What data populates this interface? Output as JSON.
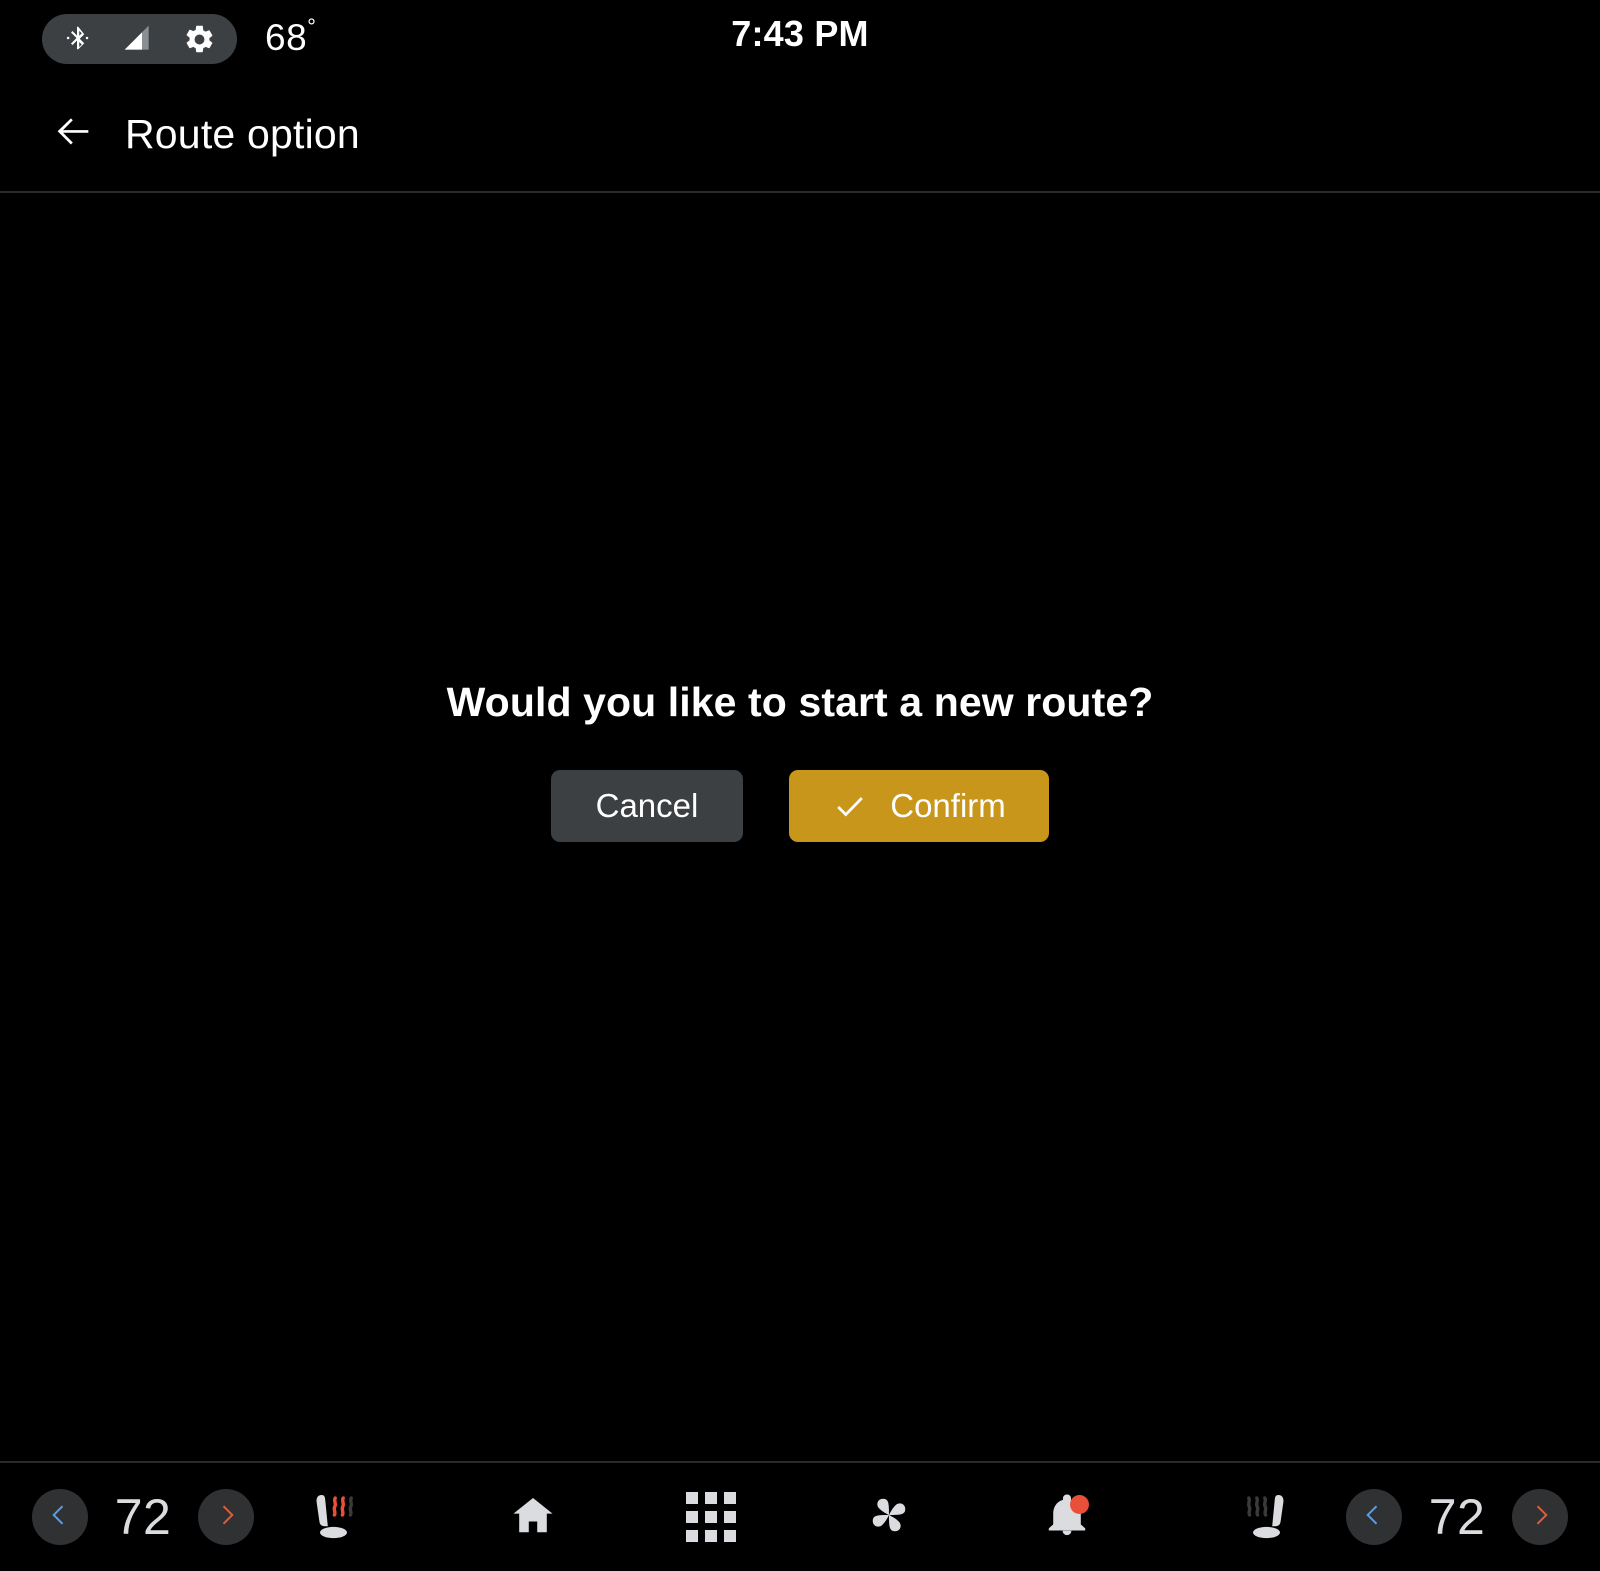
{
  "status_bar": {
    "icons": [
      {
        "name": "bluetooth-icon",
        "label": "bluetooth"
      },
      {
        "name": "cell-signal-icon",
        "label": "cell-signal"
      },
      {
        "name": "gear-icon",
        "label": "settings"
      }
    ],
    "outside_temperature": "68",
    "degree_symbol": "°",
    "clock": "7:43 PM",
    "pill_background": "#3C4043"
  },
  "app_bar": {
    "back_icon": "arrow-left-icon",
    "title": "Route option",
    "divider_color": "#2A2A2A"
  },
  "dialog": {
    "message": "Would you like to start a new route?",
    "cancel_label": "Cancel",
    "confirm_label": "Confirm",
    "confirm_icon": "check-icon",
    "cancel_color": "#3C4043",
    "confirm_color": "#C9961C"
  },
  "nav_bar": {
    "left_climate": {
      "decrease_icon": "chevron-left-icon",
      "temperature": "72",
      "increase_icon": "chevron-right-icon",
      "decrease_color": "#5B9FE0",
      "increase_color": "#E05C3E"
    },
    "left_seat_heater": {
      "icon": "seat-heater-left-icon",
      "state": "on",
      "wave_color": "#E8503A"
    },
    "center_items": [
      {
        "name": "home-icon",
        "label": "Home"
      },
      {
        "name": "apps-grid-icon",
        "label": "Apps"
      },
      {
        "name": "fan-icon",
        "label": "Climate"
      },
      {
        "name": "notifications-bell-icon",
        "label": "Notifications",
        "badge": true
      }
    ],
    "right_seat_heater": {
      "icon": "seat-heater-right-icon",
      "state": "off",
      "wave_color": "#3A3A3A"
    },
    "right_climate": {
      "decrease_icon": "chevron-left-icon",
      "temperature": "72",
      "increase_icon": "chevron-right-icon",
      "decrease_color": "#5B9FE0",
      "increase_color": "#E05C3E"
    },
    "icon_color": "#DADCE0",
    "background": "#000000"
  }
}
